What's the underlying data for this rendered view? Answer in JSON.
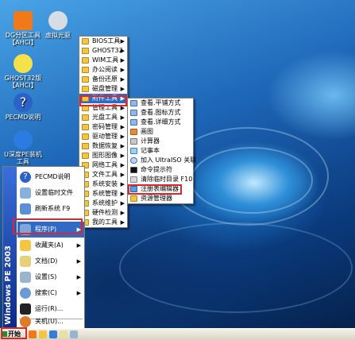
{
  "desktop_icons": [
    {
      "label": "DG分区工具\n【AHCI】"
    },
    {
      "label": "虚拟光驱"
    },
    {
      "label": "GHOST32版\n【AHCI】"
    },
    {
      "label": "PECMD说明"
    },
    {
      "label": "U深度PE装机\n工具"
    }
  ],
  "programs_menu": {
    "items": [
      {
        "label": "BIOS工具"
      },
      {
        "label": "GHOST32"
      },
      {
        "label": "WIM工具"
      },
      {
        "label": "办公阅读"
      },
      {
        "label": "备份还原"
      },
      {
        "label": "磁盘管理"
      },
      {
        "label": "附件工具"
      },
      {
        "label": "管理工具"
      },
      {
        "label": "光盘工具"
      },
      {
        "label": "密码管理"
      },
      {
        "label": "驱动管理"
      },
      {
        "label": "数据恢复"
      },
      {
        "label": "图形图像"
      },
      {
        "label": "网络工具"
      },
      {
        "label": "文件工具"
      },
      {
        "label": "系统安装"
      },
      {
        "label": "系统管理"
      },
      {
        "label": "系统维护"
      },
      {
        "label": "硬件检测"
      },
      {
        "label": "我的工具"
      }
    ]
  },
  "accessories_menu": {
    "items": [
      {
        "label": "查看.平铺方式"
      },
      {
        "label": "查看.图标方式"
      },
      {
        "label": "查看.详细方式"
      },
      {
        "label": "画图"
      },
      {
        "label": "计算器"
      },
      {
        "label": "记事本"
      },
      {
        "label": "加入 UltraISO 关联"
      },
      {
        "label": "命令提示符"
      },
      {
        "label": "清除临时目录 F10"
      },
      {
        "label": "注册表编辑器"
      },
      {
        "label": "资源管理器"
      }
    ]
  },
  "start_menu": {
    "band_text": "Windows PE 2003",
    "items": [
      {
        "label": "PECMD说明"
      },
      {
        "label": "设置临时文件"
      },
      {
        "label": "刷新系统 F9"
      },
      {
        "label": "程序(P)"
      },
      {
        "label": "收藏夹(A)"
      },
      {
        "label": "文档(D)"
      },
      {
        "label": "设置(S)"
      },
      {
        "label": "搜索(C)"
      },
      {
        "label": "运行(R)..."
      },
      {
        "label": "关机(U)..."
      }
    ]
  },
  "taskbar": {
    "start_label": "开始"
  },
  "colors": {
    "highlight": "#316ac5",
    "annotation_red": "#e0262b",
    "band": "#0a2a8a"
  }
}
